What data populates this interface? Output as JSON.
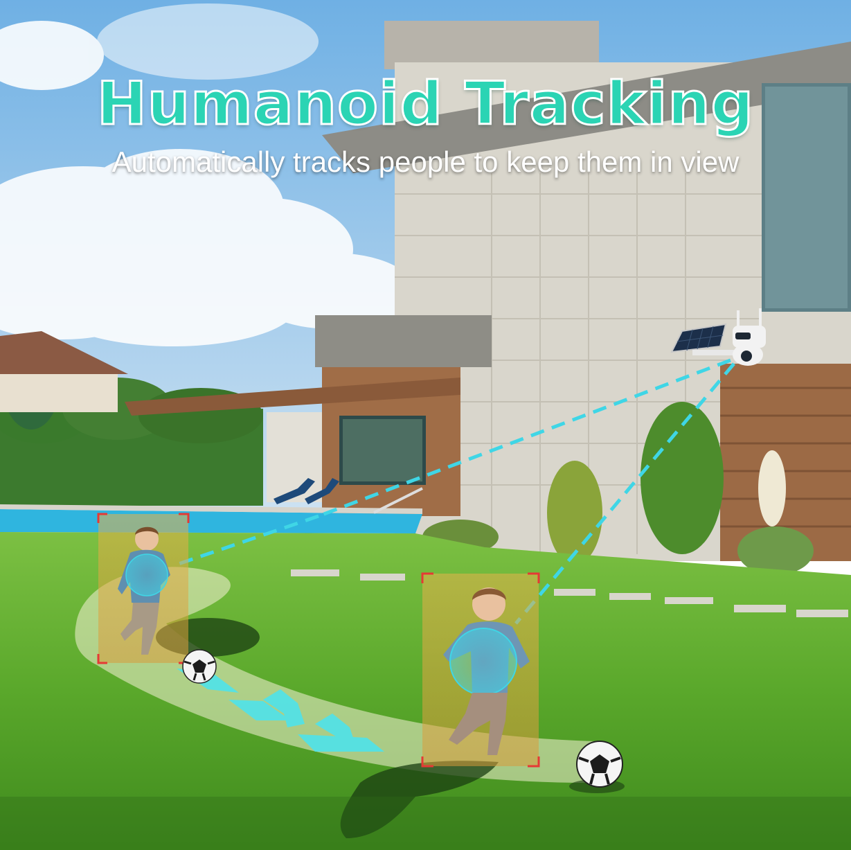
{
  "title": "Humanoid Tracking",
  "subtitle": "Automatically tracks people to keep them in view",
  "colors": {
    "title": "#2bd4b4",
    "tracking_line": "#3fd6e6",
    "detection_box": "#e53935",
    "path_arrows": "#4fe3ea",
    "grass": "#5cae2e",
    "sky": "#8fc3ea"
  },
  "scene": {
    "subjects": [
      "child-running-left",
      "child-running-right"
    ],
    "objects": [
      "soccer-ball",
      "soccer-ball",
      "solar-panel",
      "security-camera",
      "pool",
      "house"
    ]
  }
}
